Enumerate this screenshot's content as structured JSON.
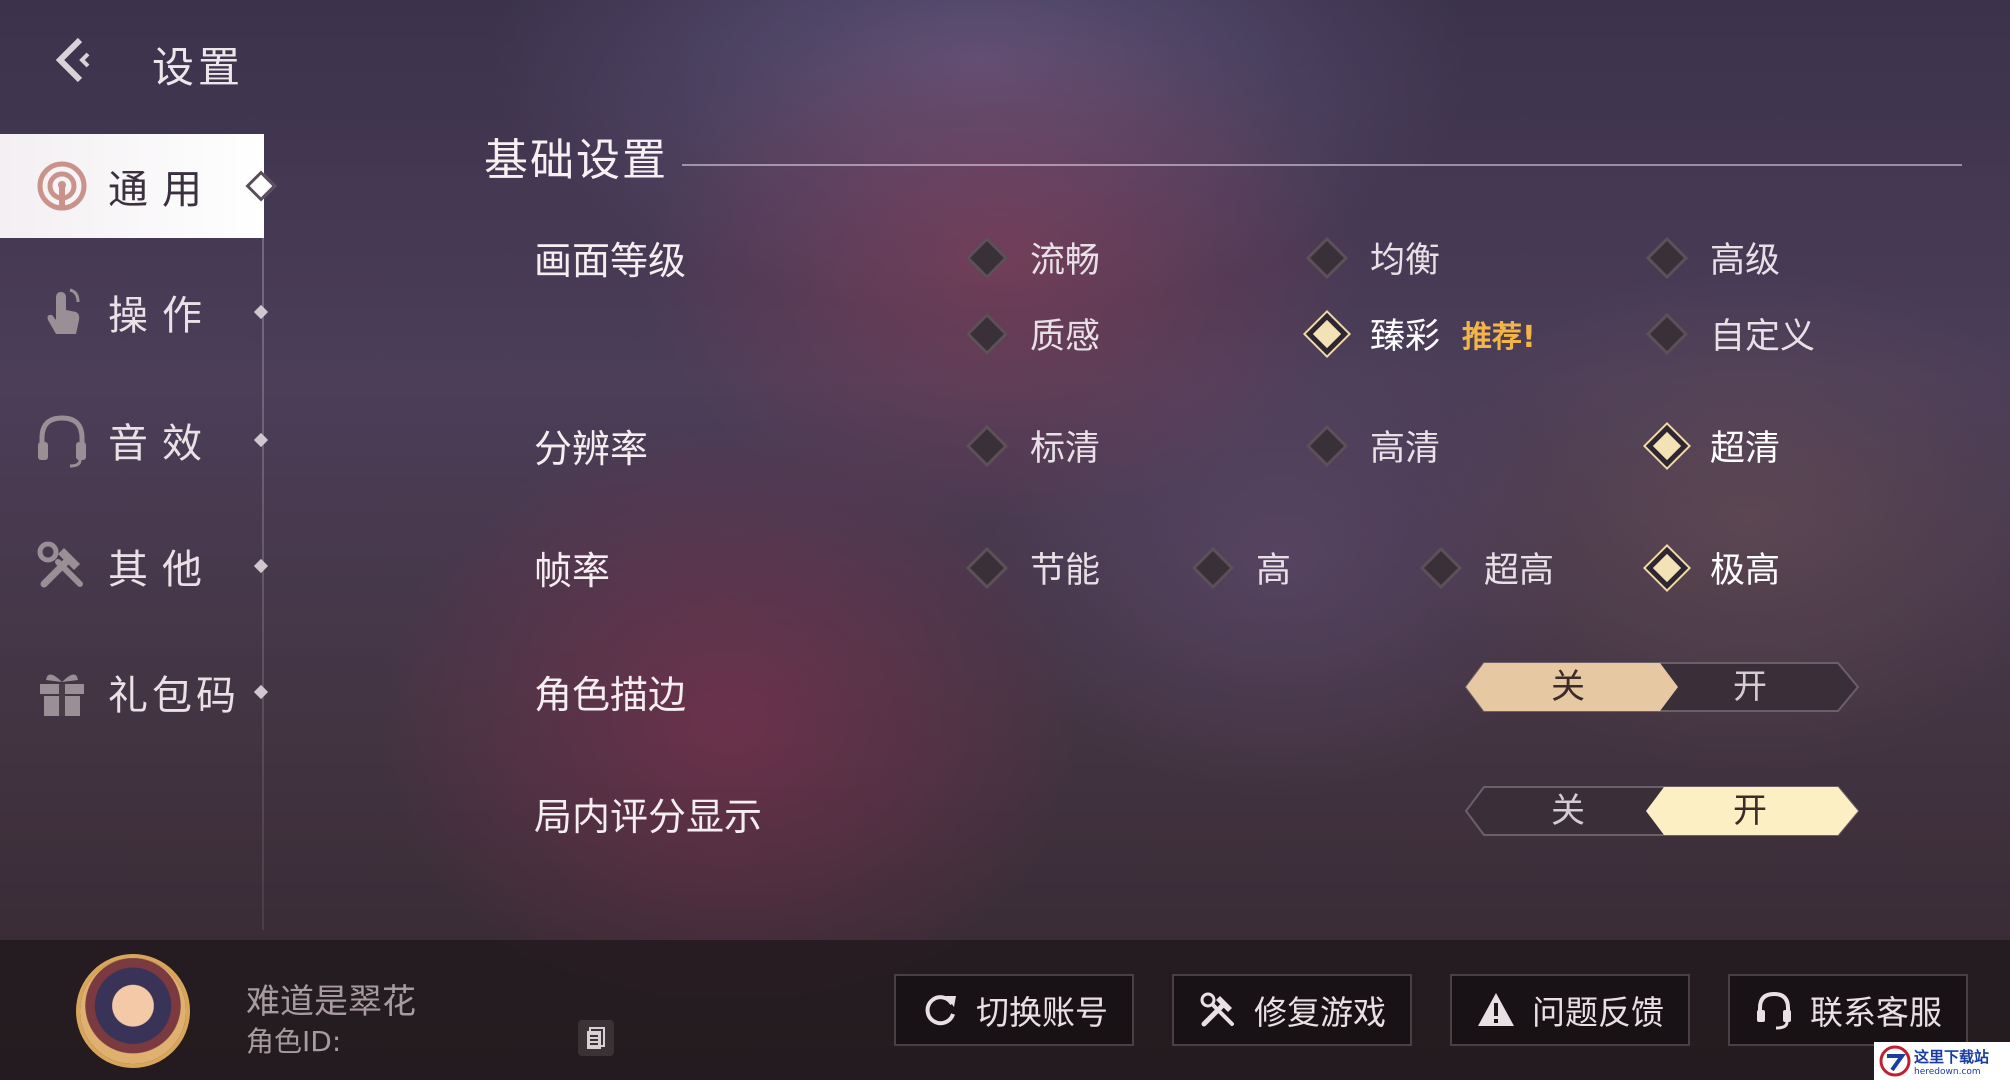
{
  "header": {
    "title": "设置"
  },
  "sidebar": {
    "items": [
      {
        "label": "通用",
        "icon": "radio-signal-icon",
        "active": true
      },
      {
        "label": "操作",
        "icon": "touch-hand-icon",
        "active": false
      },
      {
        "label": "音效",
        "icon": "headphones-icon",
        "active": false
      },
      {
        "label": "其他",
        "icon": "tools-icon",
        "active": false
      },
      {
        "label": "礼包码",
        "icon": "gift-icon",
        "active": false
      }
    ]
  },
  "section": {
    "title": "基础设置"
  },
  "settings": {
    "graphics": {
      "label": "画面等级",
      "options": [
        "流畅",
        "均衡",
        "高级",
        "质感",
        "臻彩",
        "自定义"
      ],
      "selected": "臻彩",
      "badge": "推荐!"
    },
    "resolution": {
      "label": "分辨率",
      "options": [
        "标清",
        "高清",
        "超清"
      ],
      "selected": "超清"
    },
    "framerate": {
      "label": "帧率",
      "options": [
        "节能",
        "高",
        "超高",
        "极高"
      ],
      "selected": "极高"
    },
    "outline": {
      "label": "角色描边",
      "off": "关",
      "on": "开",
      "value": "关"
    },
    "score_display": {
      "label": "局内评分显示",
      "off": "关",
      "on": "开",
      "value": "开"
    }
  },
  "player": {
    "name": "难道是翠花",
    "id_label": "角色ID:"
  },
  "bottom_buttons": [
    {
      "label": "切换账号",
      "icon": "refresh-icon"
    },
    {
      "label": "修复游戏",
      "icon": "repair-tools-icon"
    },
    {
      "label": "问题反馈",
      "icon": "warning-icon"
    },
    {
      "label": "联系客服",
      "icon": "headset-icon"
    }
  ],
  "watermark": {
    "line1": "这里下载站",
    "line2": "heredown.com"
  },
  "colors": {
    "selected_toggle": "#fcefc4",
    "inactive_toggle_left": "#e8cba4",
    "badge": "#f3b54a"
  }
}
